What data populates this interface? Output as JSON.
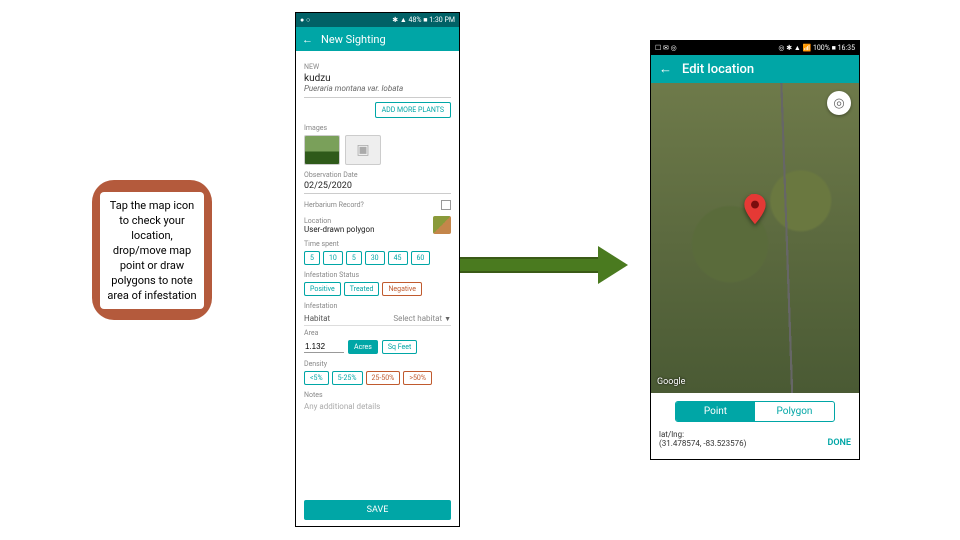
{
  "callout_text": "Tap the map icon to check your location, drop/move map point or draw polygons to note area of infestation",
  "phone1": {
    "status_left": "● ○",
    "status_right": "✱ ▲ 48% ■ 1:30 PM",
    "app_title": "New Sighting",
    "labels": {
      "species": "NEW",
      "images": "Images",
      "obs_date_label": "Observation Date",
      "obs_date": "02/25/2020",
      "herb": "Herbarium Record?",
      "location": "Location",
      "location_val": "User-drawn polygon",
      "time_spent": "Time spent",
      "inf_status": "Infestation Status",
      "infestation": "Infestation",
      "habitat": "Habitat",
      "habitat_val": "Select habitat",
      "area": "Area",
      "density": "Density",
      "notes": "Notes",
      "notes_ph": "Any additional details"
    },
    "species_common": "kudzu",
    "species_latin": "Pueraria montana var. lobata",
    "add_more": "ADD MORE PLANTS",
    "time_chips": [
      "5",
      "10",
      "5",
      "30",
      "45",
      "60"
    ],
    "status_chips": [
      "Positive",
      "Treated",
      "Negative"
    ],
    "area_value": "1.132",
    "area_units": [
      "Acres",
      "Sq Feet"
    ],
    "density_chips": [
      "<5%",
      "5-25%",
      "25-50%",
      ">50%"
    ],
    "save": "SAVE"
  },
  "phone2": {
    "status_left": "☐ ✉ ◎",
    "status_right": "◎ ✱ ▲ 📶 100% ■ 16:35",
    "app_title": "Edit location",
    "google": "Google",
    "seg_point": "Point",
    "seg_polygon": "Polygon",
    "latlng_label": "lat/lng:",
    "latlng_val": "(31.478574, -83.523576)",
    "done": "DONE"
  }
}
